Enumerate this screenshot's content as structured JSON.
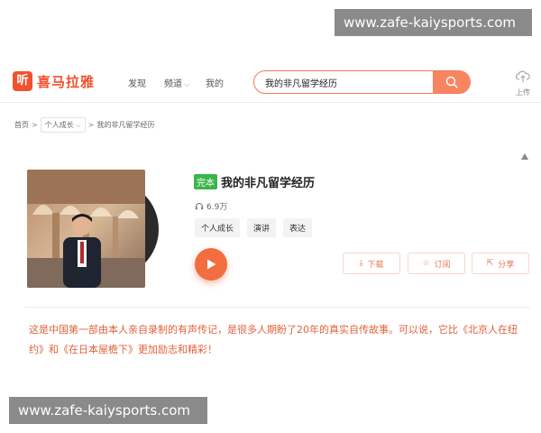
{
  "watermark": {
    "text": "www.zafe-kaiysports.com"
  },
  "header": {
    "logo_glyph": "听",
    "logo_text": "喜马拉雅",
    "nav": {
      "find": "发现",
      "channel": "频道",
      "mine": "我的"
    },
    "search": {
      "value": "我的非凡留学经历"
    },
    "upload_label": "上传"
  },
  "breadcrumb": {
    "home": "首页",
    "category": "个人成长",
    "current": "我的非凡留学经历"
  },
  "album": {
    "badge": "完本",
    "title": "我的非凡留学经历",
    "play_count": "6.9万",
    "tags": [
      "个人成长",
      "演讲",
      "表达"
    ]
  },
  "actions": {
    "download": "下载",
    "subscribe": "订阅",
    "share": "分享"
  },
  "description": "这是中国第一部由本人亲自录制的有声传记，是很多人期盼了20年的真实自传故事。可以说，它比《北京人在纽约》和《在日本屋檐下》更加励志和精彩！",
  "colors": {
    "accent": "#f0522f",
    "badge_green": "#3bb54a",
    "description": "#e0613b"
  },
  "icons": [
    "search-icon",
    "upload-cloud-icon",
    "headphones-icon",
    "play-icon",
    "download-icon",
    "star-icon",
    "share-icon",
    "chevron-down-icon",
    "chevron-up-icon"
  ]
}
